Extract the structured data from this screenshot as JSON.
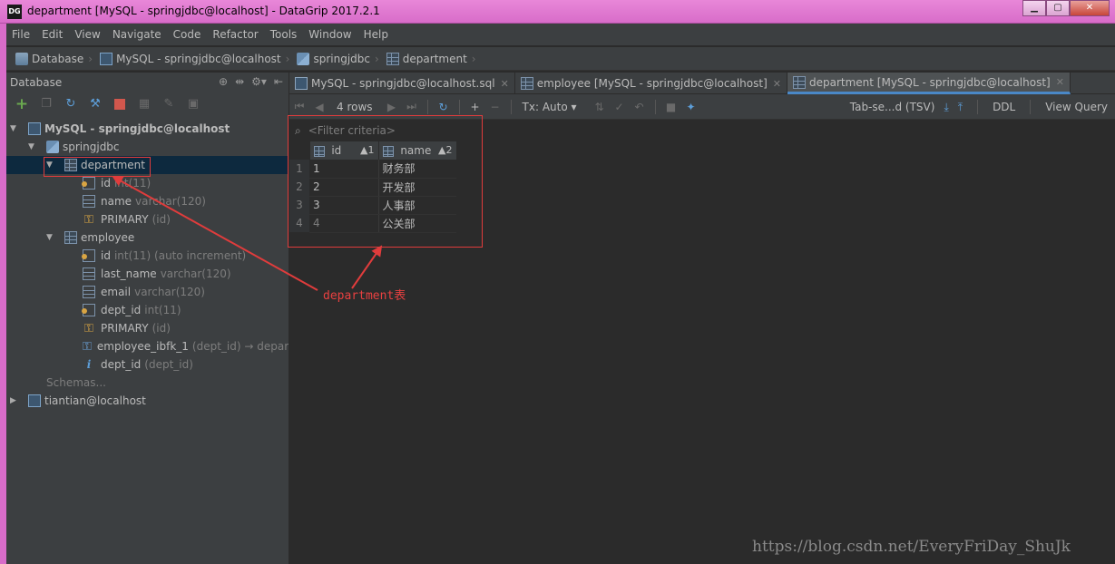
{
  "window": {
    "title": "department [MySQL - springjdbc@localhost] - DataGrip 2017.2.1",
    "app_icon": "DG"
  },
  "menu": [
    "File",
    "Edit",
    "View",
    "Navigate",
    "Code",
    "Refactor",
    "Tools",
    "Window",
    "Help"
  ],
  "breadcrumb": [
    "Database",
    "MySQL - springjdbc@localhost",
    "springjdbc",
    "department"
  ],
  "left_panel": {
    "title": "Database",
    "tree": {
      "connection": "MySQL - springjdbc@localhost",
      "schema": "springjdbc",
      "table1": {
        "name": "department",
        "col_id": "id",
        "col_id_type": "int(11)",
        "col_name": "name",
        "col_name_type": "varchar(120)",
        "pk": "PRIMARY",
        "pk_cols": "(id)"
      },
      "table2": {
        "name": "employee",
        "col_id": "id",
        "col_id_type": "int(11) (auto increment)",
        "col_last_name": "last_name",
        "col_last_name_type": "varchar(120)",
        "col_email": "email",
        "col_email_type": "varchar(120)",
        "col_dept_id": "dept_id",
        "col_dept_id_type": "int(11)",
        "pk": "PRIMARY",
        "pk_cols": "(id)",
        "fk": "employee_ibfk_1",
        "fk_detail": "(dept_id) → departme",
        "idx": "dept_id",
        "idx_cols": "(dept_id)"
      },
      "schemas": "Schemas...",
      "other_connection": "tiantian@localhost"
    }
  },
  "tabs": [
    {
      "label": "MySQL - springjdbc@localhost.sql",
      "active": false
    },
    {
      "label": "employee [MySQL - springjdbc@localhost]",
      "active": false
    },
    {
      "label": "department [MySQL - springjdbc@localhost]",
      "active": true
    }
  ],
  "grid_toolbar": {
    "rows": "4 rows",
    "tx": "Tx: Auto",
    "export_format": "Tab-se...d (TSV)",
    "ddl": "DDL",
    "view_query": "View Query"
  },
  "grid": {
    "filter_placeholder": "<Filter criteria>",
    "columns": [
      {
        "name": "id",
        "sort": "▲1"
      },
      {
        "name": "name",
        "sort": "▲2"
      }
    ],
    "rows": [
      {
        "n": "1",
        "id": "1",
        "name": "财务部"
      },
      {
        "n": "2",
        "id": "2",
        "name": "开发部"
      },
      {
        "n": "3",
        "id": "3",
        "name": "人事部"
      },
      {
        "n": "4",
        "id": "4",
        "name": "公关部"
      }
    ]
  },
  "annotation": {
    "label": "department表",
    "color": "#e03c3c"
  },
  "watermark": "https://blog.csdn.net/EveryFriDay_ShuJk",
  "colors": {
    "title_bar": "#d86cc9",
    "panel": "#3c3f41",
    "editor_bg": "#2b2b2b",
    "selection": "#0d293e",
    "accent": "#4a88c7"
  }
}
